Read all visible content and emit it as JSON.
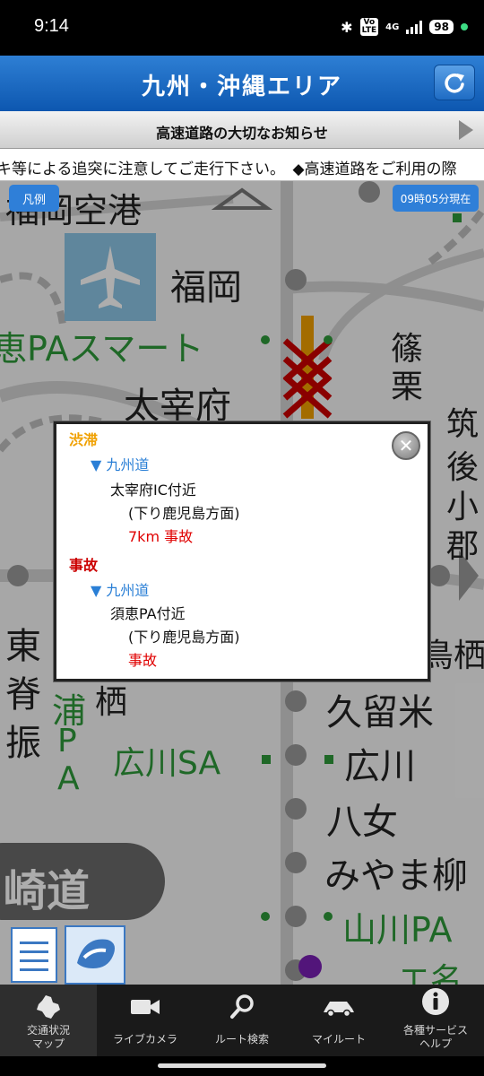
{
  "status_bar": {
    "time": "9:14",
    "bluetooth_icon": "bluetooth-icon",
    "volte_top": "Vo",
    "volte_bottom": "LTE",
    "network": "4G",
    "battery": "98"
  },
  "header": {
    "title": "九州・沖縄エリア",
    "refresh_icon": "refresh-icon"
  },
  "notice": {
    "title": "高速道路の大切なお知らせ"
  },
  "ticker": {
    "text": "キ等による追突に注意してご走行下さい。　◆高速道路をご利用の際"
  },
  "map": {
    "legend_button": "凡例",
    "timestamp": "09時05分現在",
    "labels": {
      "airport": "福岡空港",
      "fukuoka": "福岡",
      "sue_pa_smart": "恵PAスマート",
      "dazaifu": "太宰府",
      "sasaguri_1": "篠",
      "sasaguri_2": "栗",
      "chikugo_1": "筑",
      "chikugo_2": "後",
      "chikugo_3": "小",
      "chikugo_4": "郡",
      "higashi_1": "東",
      "higashi_2": "脊",
      "higashi_3": "振",
      "ura_1": "浦",
      "ura_2": "P",
      "ura_3": "A",
      "tosu_right": "鳥栖",
      "tosu_left": "栖",
      "kurume": "久留米",
      "hirokawa_sa": "広川SA",
      "hirokawa": "広川",
      "yame": "八女",
      "miyama": "みやま柳",
      "nagasaki_road": "崎道",
      "yamakawa_pa": "山川PA",
      "bottom_right": "エ名"
    },
    "road_colors": {
      "jam": "#f0a000",
      "accident": "#cc0000",
      "ic_green": "#2e9a3a",
      "ic_purple": "#7a1fb4"
    }
  },
  "popup": {
    "close_icon": "close-icon",
    "sections": [
      {
        "category": "渋滞",
        "road": "▼ 九州道",
        "location": "太宰府IC付近",
        "direction": "(下り鹿児島方面)",
        "detail": "7km 事故"
      },
      {
        "category": "事故",
        "road": "▼ 九州道",
        "location": "須恵PA付近",
        "direction": "(下り鹿児島方面)",
        "detail": "事故"
      }
    ]
  },
  "tabs": [
    {
      "label_1": "交通状況",
      "label_2": "マップ",
      "icon": "kyushu-map-icon",
      "active": true
    },
    {
      "label_1": "ライブカメラ",
      "label_2": "",
      "icon": "video-camera-icon",
      "active": false
    },
    {
      "label_1": "ルート検索",
      "label_2": "",
      "icon": "magnifier-icon",
      "active": false
    },
    {
      "label_1": "マイルート",
      "label_2": "",
      "icon": "car-icon",
      "active": false
    },
    {
      "label_1": "各種サービス",
      "label_2": "ヘルプ",
      "icon": "info-icon",
      "active": false
    }
  ]
}
